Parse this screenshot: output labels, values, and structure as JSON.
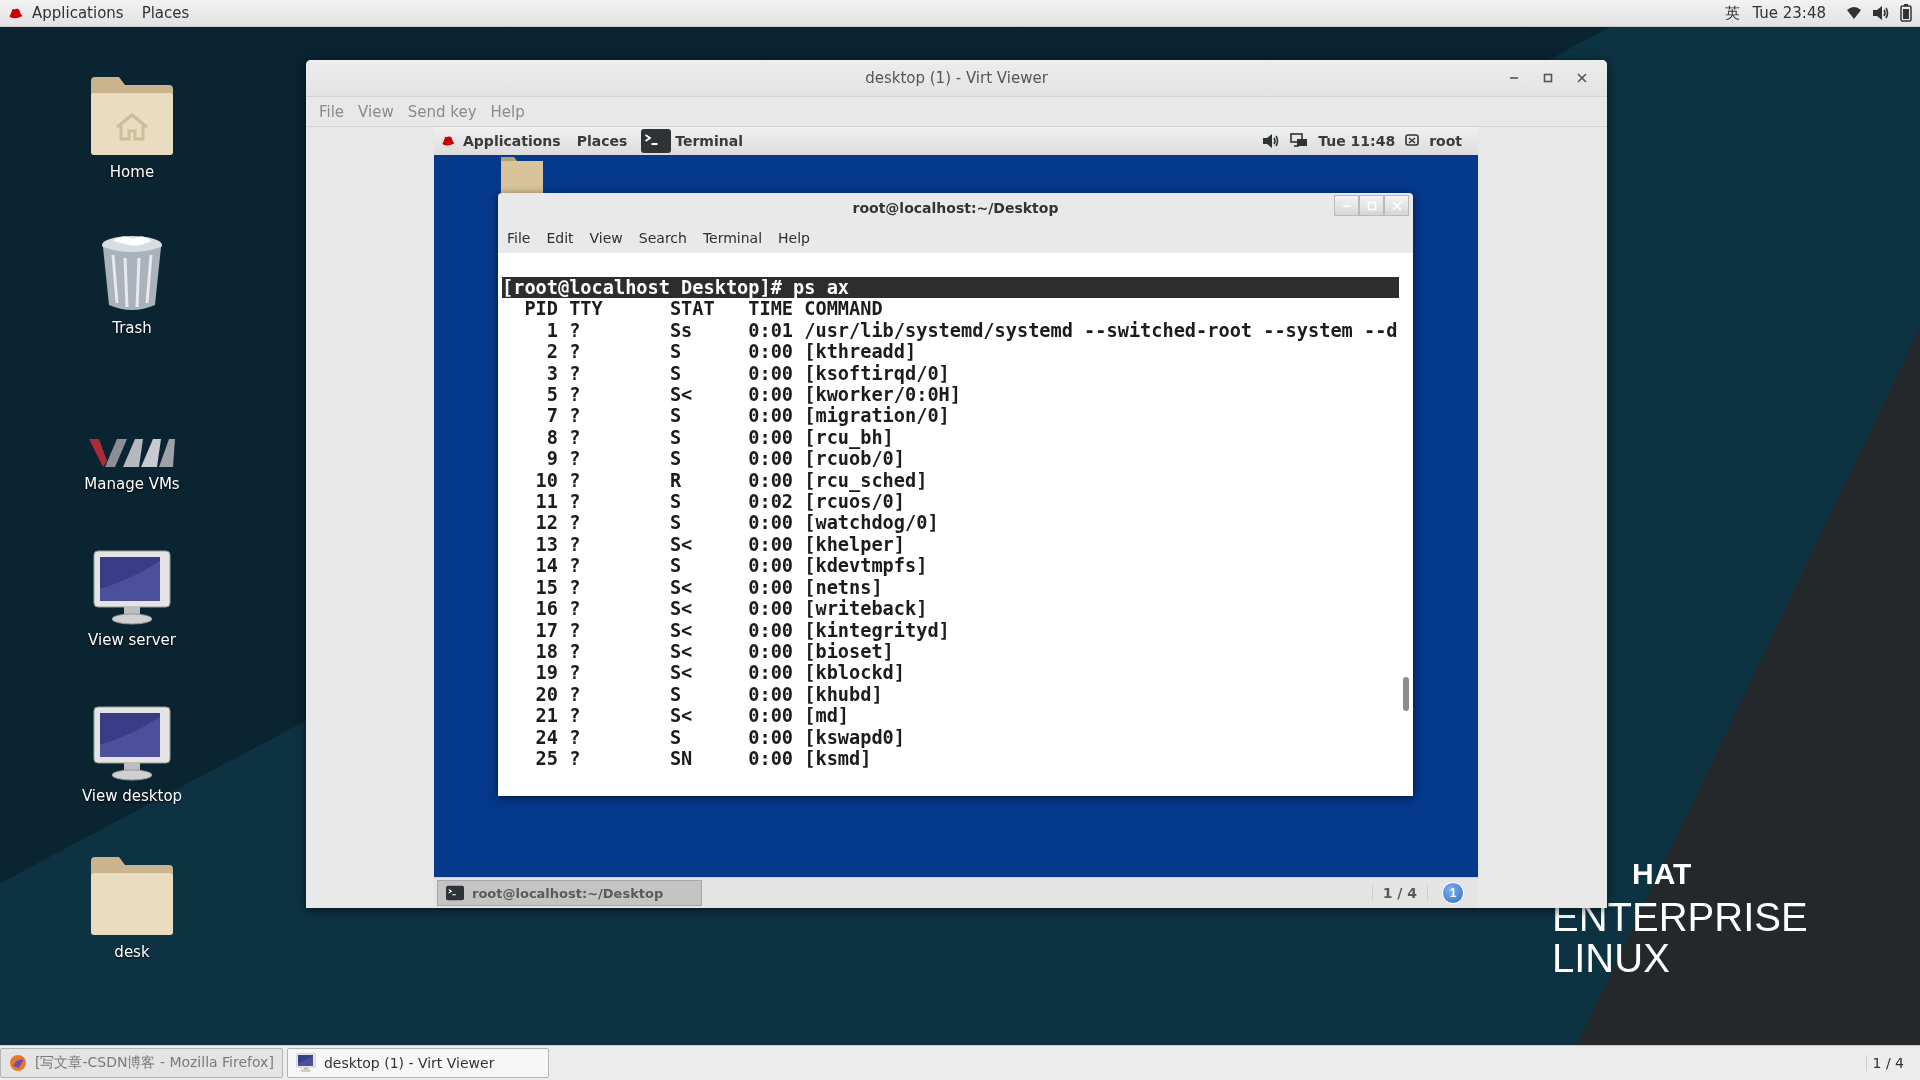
{
  "top_bar": {
    "menus": [
      "Applications",
      "Places"
    ],
    "input_method": "英",
    "clock": "Tue 23:48"
  },
  "desktop_icons": [
    {
      "label": "Home",
      "kind": "home-folder"
    },
    {
      "label": "Trash",
      "kind": "trash"
    },
    {
      "label": "Manage VMs",
      "kind": "vm"
    },
    {
      "label": "View server",
      "kind": "monitor"
    },
    {
      "label": "View desktop",
      "kind": "monitor"
    },
    {
      "label": "desk",
      "kind": "folder"
    }
  ],
  "wallpaper_logo": [
    "HAT",
    "ENTERPRISE",
    "LINUX"
  ],
  "viewer_window": {
    "title": "desktop (1) - Virt Viewer",
    "menus": [
      "File",
      "View",
      "Send key",
      "Help"
    ],
    "guest": {
      "top_bar": {
        "menus": [
          "Applications",
          "Places"
        ],
        "active_app": "Terminal",
        "clock": "Tue 11:48",
        "user": "root"
      },
      "terminal": {
        "title": "root@localhost:~/Desktop",
        "menus": [
          "File",
          "Edit",
          "View",
          "Search",
          "Terminal",
          "Help"
        ],
        "prompt": "[root@localhost Desktop]# ps ax",
        "lines": [
          "  PID TTY      STAT   TIME COMMAND",
          "    1 ?        Ss     0:01 /usr/lib/systemd/systemd --switched-root --system --d",
          "    2 ?        S      0:00 [kthreadd]",
          "    3 ?        S      0:00 [ksoftirqd/0]",
          "    5 ?        S<     0:00 [kworker/0:0H]",
          "    7 ?        S      0:00 [migration/0]",
          "    8 ?        S      0:00 [rcu_bh]",
          "    9 ?        S      0:00 [rcuob/0]",
          "   10 ?        R      0:00 [rcu_sched]",
          "   11 ?        S      0:02 [rcuos/0]",
          "   12 ?        S      0:00 [watchdog/0]",
          "   13 ?        S<     0:00 [khelper]",
          "   14 ?        S      0:00 [kdevtmpfs]",
          "   15 ?        S<     0:00 [netns]",
          "   16 ?        S<     0:00 [writeback]",
          "   17 ?        S<     0:00 [kintegrityd]",
          "   18 ?        S<     0:00 [bioset]",
          "   19 ?        S<     0:00 [kblockd]",
          "   20 ?        S      0:00 [khubd]",
          "   21 ?        S<     0:00 [md]",
          "   24 ?        S      0:00 [kswapd0]",
          "   25 ?        SN     0:00 [ksmd]"
        ]
      },
      "bottom_bar": {
        "task": "root@localhost:~/Desktop",
        "workspace": "1 / 4",
        "notifications": "1"
      }
    }
  },
  "taskbar": {
    "tasks": [
      {
        "label": "[写文章-CSDN博客 - Mozilla Firefox]",
        "kind": "browser",
        "selected": false
      },
      {
        "label": "desktop (1) - Virt Viewer",
        "kind": "viewer",
        "selected": true
      }
    ],
    "workspace": "1 / 4"
  }
}
